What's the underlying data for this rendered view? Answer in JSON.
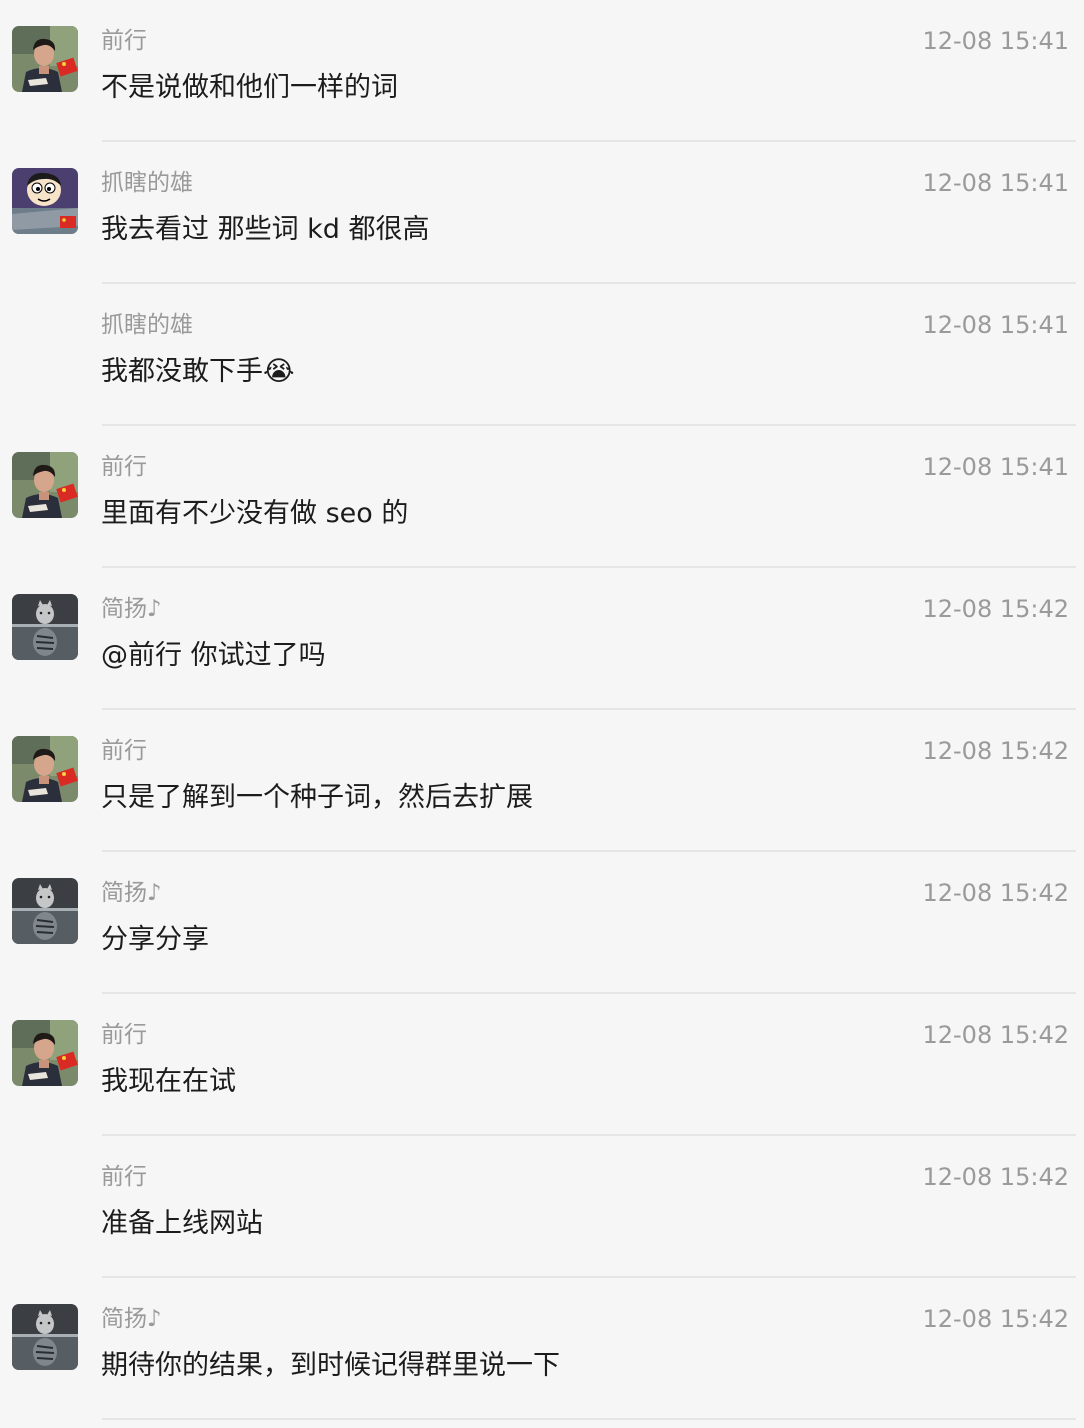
{
  "messages": [
    {
      "sender": "前行",
      "time": "12-08 15:41",
      "text": "不是说做和他们一样的词",
      "avatar": "man-with-flag-avatar"
    },
    {
      "sender": "抓瞎的雄",
      "time": "12-08 15:41",
      "text": "我去看过 那些词 kd 都很高",
      "avatar": "cartoon-boy-avatar"
    },
    {
      "sender": "抓瞎的雄",
      "time": "12-08 15:41",
      "text": "我都没敢下手",
      "emoji": "😭",
      "avatar": ""
    },
    {
      "sender": "前行",
      "time": "12-08 15:41",
      "text": "里面有不少没有做 seo 的",
      "avatar": "man-with-flag-avatar"
    },
    {
      "sender": "简扬♪",
      "time": "12-08 15:42",
      "text": "@前行 你试过了吗",
      "avatar": "cat-tiger-reflection-avatar"
    },
    {
      "sender": "前行",
      "time": "12-08 15:42",
      "text": "只是了解到一个种子词，然后去扩展",
      "avatar": "man-with-flag-avatar"
    },
    {
      "sender": "简扬♪",
      "time": "12-08 15:42",
      "text": "分享分享",
      "avatar": "cat-tiger-reflection-avatar"
    },
    {
      "sender": "前行",
      "time": "12-08 15:42",
      "text": "我现在在试",
      "avatar": "man-with-flag-avatar"
    },
    {
      "sender": "前行",
      "time": "12-08 15:42",
      "text": "准备上线网站",
      "avatar": ""
    },
    {
      "sender": "简扬♪",
      "time": "12-08 15:42",
      "text": "期待你的结果，到时候记得群里说一下",
      "avatar": "cat-tiger-reflection-avatar"
    }
  ]
}
